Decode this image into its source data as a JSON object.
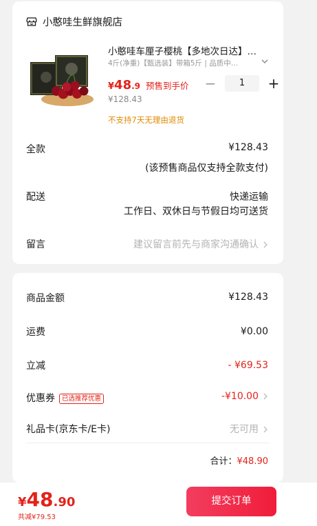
{
  "store": {
    "name": "小憨哇生鲜旗舰店",
    "icon": "store-icon"
  },
  "product": {
    "title": "小憨哇车厘子樱桃【多地次日达】…",
    "spec": "4斤(净重)【甄选装】带箱5斤 | 品质中…",
    "price_currency": "¥",
    "price_int": "48",
    "price_dec": ".9",
    "price_tag": "预售到手价",
    "orig_price": "¥128.43",
    "quantity": "1",
    "minus": "−",
    "plus": "+",
    "return_note": "不支持7天无理由退货"
  },
  "order_rows": {
    "full_label": "全款",
    "full_value": "¥128.43",
    "full_note": "(该预售商品仅支持全款支付)",
    "delivery_label": "配送",
    "delivery_value": "快递运输",
    "delivery_note": "工作日、双休日与节假日均可送货",
    "message_label": "留言",
    "message_placeholder": "建议留言前先与商家沟通确认"
  },
  "summary": {
    "goods_label": "商品金额",
    "goods_value": "¥128.43",
    "shipping_label": "运费",
    "shipping_value": "¥0.00",
    "discount_label": "立减",
    "discount_value": "- ¥69.53",
    "coupon_label": "优惠券",
    "coupon_badge": "已选推荐优惠",
    "coupon_value": "-¥10.00",
    "gift_label": "礼品卡(京东卡/E卡)",
    "gift_value": "无可用",
    "total_label": "合计：",
    "total_value": "¥48.90"
  },
  "bottom": {
    "currency": "¥",
    "price_int": "48",
    "price_dec": ".90",
    "saved": "共减¥79.53",
    "submit": "提交订单"
  },
  "colors": {
    "accent": "#e2231a",
    "warning": "#e08a00",
    "button": "#f01d3a"
  }
}
